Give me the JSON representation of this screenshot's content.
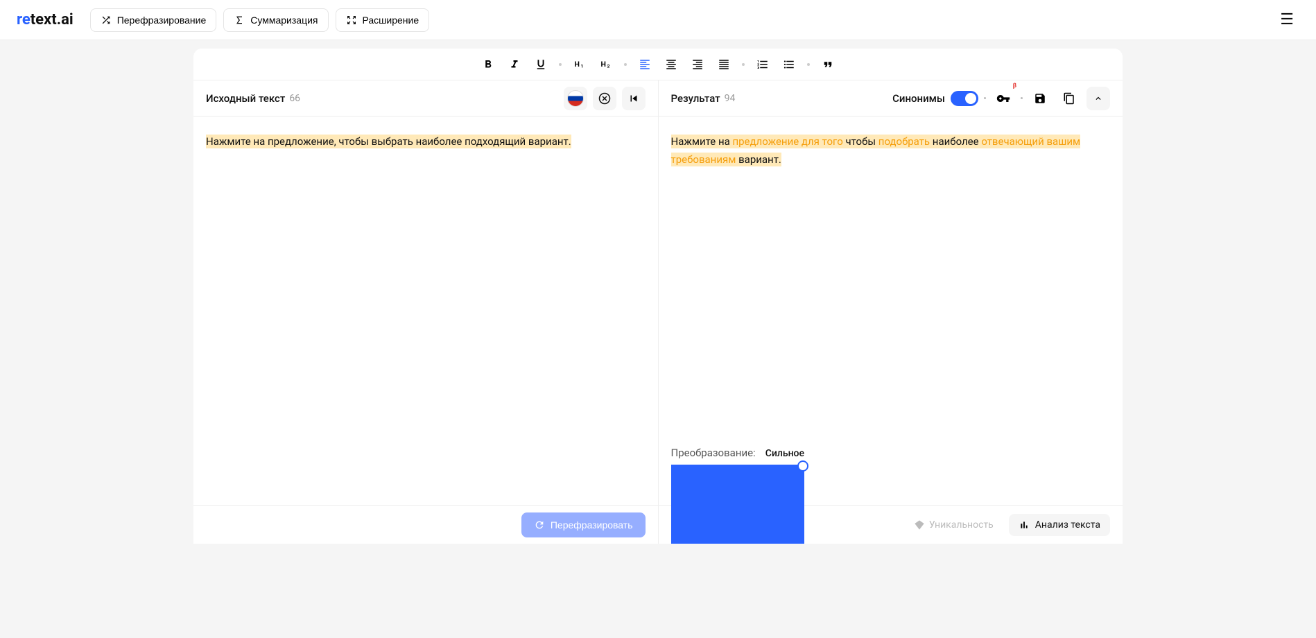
{
  "logo": {
    "prefix": "re",
    "rest": "text.ai"
  },
  "modes": {
    "rephrase": "Перефразирование",
    "summarize": "Суммаризация",
    "expand": "Расширение"
  },
  "source": {
    "title": "Исходный текст",
    "count": "66",
    "text": "Нажмите на предложение, чтобы выбрать наиболее подходящий вариант."
  },
  "result": {
    "title": "Результат",
    "count": "94",
    "synonyms_label": "Синонимы",
    "segments": [
      {
        "t": "Нажмите на ",
        "c": ""
      },
      {
        "t": "предложение для того",
        "c": "orange"
      },
      {
        "t": " чтобы ",
        "c": ""
      },
      {
        "t": "подобрать",
        "c": "orange"
      },
      {
        "t": " наиболее ",
        "c": ""
      },
      {
        "t": "отвечающий вашим требованиям",
        "c": "orange"
      },
      {
        "t": " вариант.",
        "c": ""
      }
    ],
    "beta": "β"
  },
  "footer": {
    "rephrase_btn": "Перефразировать",
    "transform_label": "Преобразование:",
    "transform_value": "Сильное",
    "uniqueness": "Уникальность",
    "analysis": "Анализ текста"
  }
}
